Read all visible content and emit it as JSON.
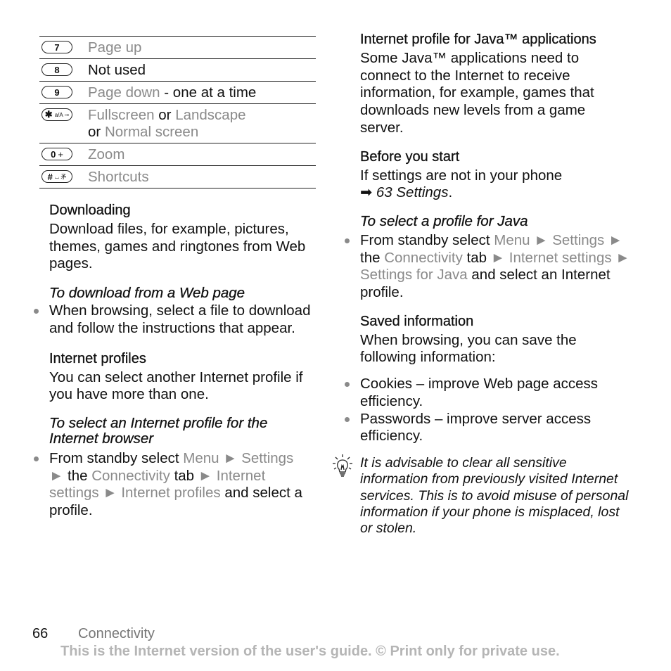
{
  "key_table": [
    {
      "key": "7",
      "key_sub": "",
      "icon": "key-7",
      "parts": [
        {
          "text": "Page up",
          "menu": true
        }
      ]
    },
    {
      "key": "8",
      "key_sub": "",
      "icon": "key-8",
      "parts": [
        {
          "text": "Not used",
          "menu": false
        }
      ]
    },
    {
      "key": "9",
      "key_sub": "",
      "icon": "key-9",
      "parts": [
        {
          "text": "Page down",
          "menu": true
        },
        {
          "text": " - one at a time",
          "menu": false
        }
      ]
    },
    {
      "key": "✱",
      "key_sub": "a/A ⊸",
      "icon": "key-star",
      "parts": [
        {
          "text": "Fullscreen",
          "menu": true
        },
        {
          "text": " or ",
          "menu": false
        },
        {
          "text": "Landscape",
          "menu": true
        },
        {
          "text": " or ",
          "menu": false
        },
        {
          "text": "Normal screen",
          "menu": true
        }
      ]
    },
    {
      "key": "0",
      "key_sub": "+",
      "icon": "key-0",
      "parts": [
        {
          "text": "Zoom",
          "menu": true
        }
      ]
    },
    {
      "key": "#",
      "key_sub": "⌴ 矛",
      "icon": "key-hash",
      "parts": [
        {
          "text": "Shortcuts",
          "menu": true
        }
      ]
    }
  ],
  "left": {
    "downloading": {
      "heading": "Downloading",
      "body": "Download files, for example, pictures, themes, games and ringtones from Web pages.",
      "instruction_title": "To download from a Web page",
      "bullet": "When browsing, select a file to download and follow the instructions that appear."
    },
    "profiles": {
      "heading": "Internet profiles",
      "body": "You can select another Internet profile if you have more than one.",
      "instruction_title": "To select an Internet profile for the Internet browser",
      "bullet_parts": [
        {
          "text": "From standby select ",
          "menu": false
        },
        {
          "text": "Menu",
          "menu": true
        },
        {
          "text": " ► ",
          "menu": true
        },
        {
          "text": "Settings",
          "menu": true
        },
        {
          "text": " ► ",
          "menu": true
        },
        {
          "text": "the ",
          "menu": false
        },
        {
          "text": "Connectivity",
          "menu": true
        },
        {
          "text": " tab ",
          "menu": false
        },
        {
          "text": "► Internet settings ► Internet profiles",
          "menu": true
        },
        {
          "text": " and select a profile.",
          "menu": false
        }
      ]
    }
  },
  "right": {
    "java": {
      "heading": "Internet profile for Java™ applications",
      "body": "Some Java™ applications need to connect to the Internet to receive information, for example, games that downloads new levels from a game server."
    },
    "before": {
      "heading": "Before you start",
      "body": "If settings are not in your phone",
      "ref_arrow": "➡",
      "ref_text": "63 Settings",
      "ref_tail": "."
    },
    "select_java": {
      "instruction_title": "To select a profile for Java",
      "bullet_parts": [
        {
          "text": "From standby select ",
          "menu": false
        },
        {
          "text": "Menu ► Settings ►",
          "menu": true
        },
        {
          "text": " the ",
          "menu": false
        },
        {
          "text": "Connectivity",
          "menu": true
        },
        {
          "text": " tab ",
          "menu": false
        },
        {
          "text": "► Internet settings ► Settings for Java",
          "menu": true
        },
        {
          "text": " and select an Internet profile.",
          "menu": false
        }
      ]
    },
    "saved": {
      "heading": "Saved information",
      "body": "When browsing, you can save the following information:",
      "items": [
        "Cookies – improve Web page access efficiency.",
        "Passwords – improve server access efficiency."
      ]
    },
    "tip": {
      "icon": "lightbulb-icon",
      "text": "It is advisable to clear all sensitive information from previously visited Internet services. This is to avoid misuse of personal information if your phone is misplaced, lost or stolen."
    }
  },
  "footer": {
    "page_number": "66",
    "section": "Connectivity",
    "notice": "This is the Internet version of the user's guide. © Print only for private use."
  },
  "colors": {
    "text": "#111111",
    "menu_item": "#8a8a8a",
    "footer_notice": "#b5b5b5"
  }
}
